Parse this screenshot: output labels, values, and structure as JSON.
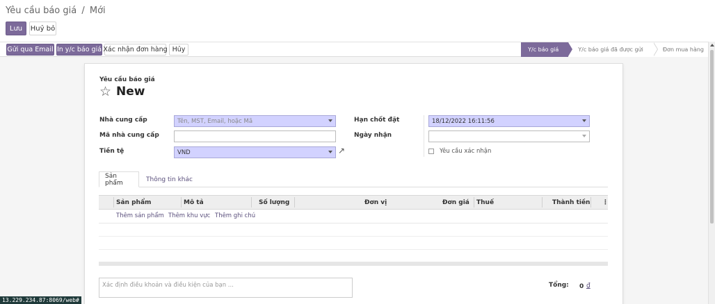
{
  "breadcrumb": {
    "parent": "Yêu cầu báo giá",
    "separator": "/",
    "current": "Mới"
  },
  "buttons": {
    "save": "Lưu",
    "discard": "Huỷ bỏ"
  },
  "header_actions": {
    "send_email": "Gửi qua Email",
    "print_rfq": "In y/c báo giá",
    "confirm_order": "Xác nhận đơn hàng",
    "cancel": "Hủy"
  },
  "status_steps": [
    "Y/c báo giá",
    "Y/c báo giá đã được gửi",
    "Đơn mua hàng"
  ],
  "active_step": 0,
  "form": {
    "doc_type": "Yêu cầu báo giá",
    "title": "New",
    "vendor_label": "Nhà cung cấp",
    "vendor_placeholder": "Tên, MST, Email, hoặc Mã",
    "vendor_ref_label": "Mã nhà cung cấp",
    "vendor_ref_value": "",
    "currency_label": "Tiền tệ",
    "currency_value": "VND",
    "deadline_label": "Hạn chốt đặt",
    "deadline_value": "18/12/2022 16:11:56",
    "receipt_label": "Ngày nhận",
    "receipt_value": "",
    "confirm_label": "Yêu cầu xác nhận"
  },
  "tabs": [
    "Sản phẩm",
    "Thông tin khác"
  ],
  "table": {
    "columns": [
      "Sản phẩm",
      "Mô tả",
      "Số lượng",
      "Đơn vị",
      "Đơn giá",
      "Thuế",
      "Thành tiền"
    ],
    "add_links": [
      "Thêm sản phẩm",
      "Thêm khu vực",
      "Thêm ghi chú"
    ]
  },
  "terms_placeholder": "Xác định điều khoản và điều kiện của bạn ...",
  "total": {
    "label": "Tổng:",
    "value": "0",
    "currency": "₫"
  },
  "status_url": "13.229.234.87:8069/web#",
  "colors": {
    "primary": "#7c6a9a",
    "required_field": "#d2d2ff",
    "link": "#5a4f7c"
  }
}
